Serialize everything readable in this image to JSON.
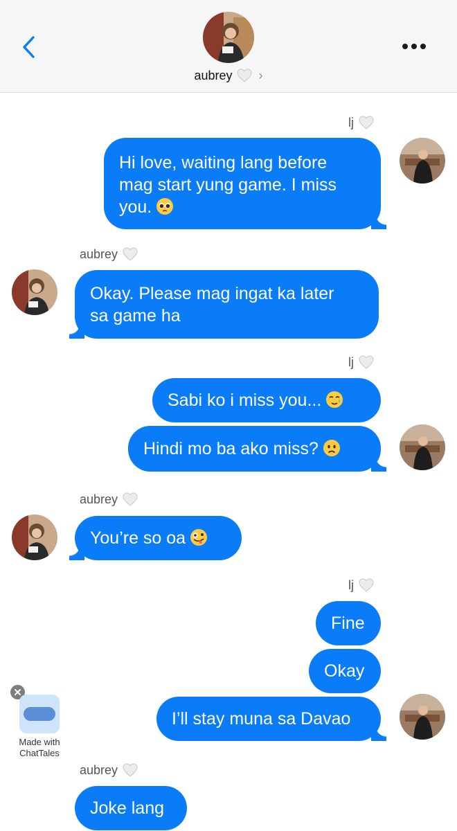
{
  "header": {
    "contact_name": "aubrey",
    "icons": {
      "back": "chevron-left-icon",
      "more": "more-dots-icon",
      "name_chevron": "chevron-right-icon"
    }
  },
  "colors": {
    "bubble": "#0b7cf7",
    "accent": "#0b7cf7",
    "header_bg": "#f6f6f6"
  },
  "messages": [
    {
      "sender": "lj",
      "side": "right",
      "text": "Hi love, waiting lang before",
      "text2": "mag start yung game. I miss",
      "text3": "you.",
      "emoji": "pleading-face"
    },
    {
      "sender": "aubrey",
      "side": "left",
      "text": "Okay. Please mag ingat ka later",
      "text2": "sa game ha"
    },
    {
      "sender": "lj",
      "side": "right",
      "text": "Sabi ko i miss you...",
      "emoji": "tearful-smile"
    },
    {
      "side": "right",
      "text": "Hindi mo ba ako miss?",
      "emoji": "frowning-face"
    },
    {
      "sender": "aubrey",
      "side": "left",
      "text": "You’re so oa",
      "emoji": "zany-face"
    },
    {
      "sender": "lj",
      "side": "right",
      "text": "Fine"
    },
    {
      "side": "right",
      "text": "Okay"
    },
    {
      "side": "right",
      "text": "I’ll stay muna sa Davao"
    },
    {
      "sender": "aubrey",
      "side": "left",
      "text": "Joke lang"
    }
  ],
  "senders": {
    "lj": "lj",
    "aubrey": "aubrey"
  },
  "watermark": {
    "line1": "Made with",
    "line2": "ChatTales",
    "icons": {
      "close": "close-icon",
      "app": "chat-bubble-icon"
    }
  }
}
